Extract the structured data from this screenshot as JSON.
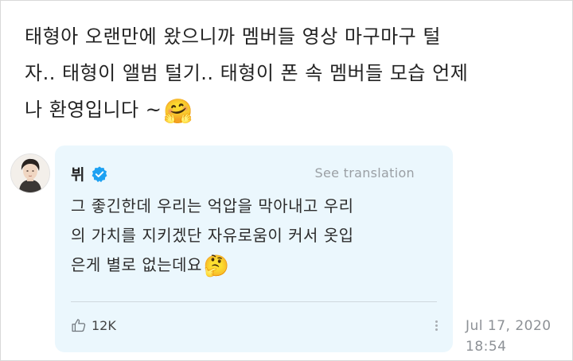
{
  "fan_message": {
    "line1": "태형아 오랜만에 왔으니까 멤버들 영상 마구마구 털",
    "line2": "자.. 태형이 앨범 털기.. 태형이 폰 속 멤버들 모습 언제",
    "line3": "나 환영입니다 ~",
    "emoji": "🤗"
  },
  "reply": {
    "author": "뷔",
    "verified_icon": "verified-badge-icon",
    "see_translation": "See translation",
    "line1": "그 좋긴한데 우리는 억압을 막아내고 우리",
    "line2": "의 가치를 지키겠단 자유로움이 커서 옷입",
    "line3": "은게 별로 없는데요",
    "emoji": "🤔",
    "likes": "12K",
    "like_icon": "thumbs-up-icon",
    "more_icon": "more-vertical-icon"
  },
  "timestamp": {
    "date": "Jul 17, 2020",
    "time": "18:54"
  },
  "colors": {
    "card_background": "#ebf7fd",
    "verified_blue": "#1da1f2",
    "muted_text": "#9a9fa4"
  }
}
